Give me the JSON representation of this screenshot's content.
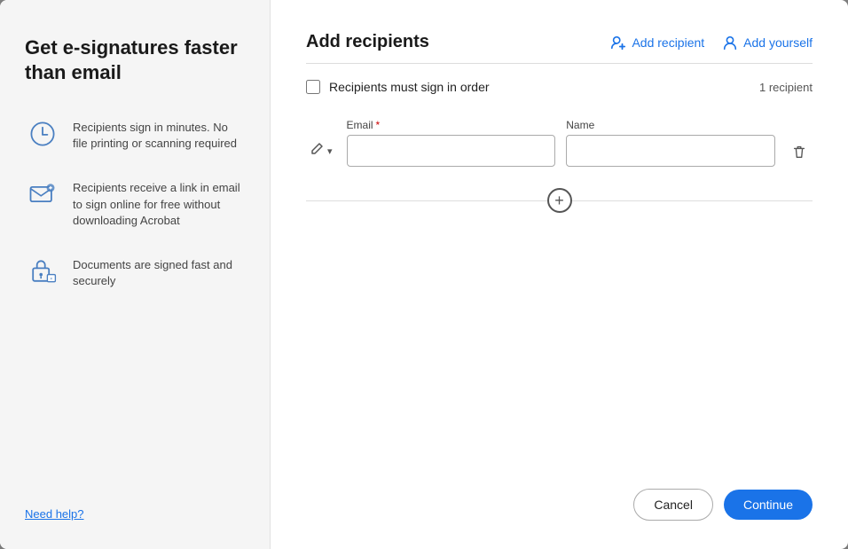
{
  "left": {
    "title": "Get e-signatures faster than email",
    "features": [
      {
        "id": "clock",
        "text": "Recipients sign in minutes. No file printing or scanning required"
      },
      {
        "id": "email",
        "text": "Recipients receive a link in email to sign online for free without downloading Acrobat"
      },
      {
        "id": "secure",
        "text": "Documents are signed fast and securely"
      }
    ],
    "help_label": "Need help?"
  },
  "right": {
    "title": "Add recipients",
    "add_recipient_label": "Add recipient",
    "add_yourself_label": "Add yourself",
    "divider": true,
    "checkbox_label": "Recipients must sign in order",
    "recipient_count": "1 recipient",
    "email_label": "Email",
    "name_label": "Name",
    "email_placeholder": "",
    "name_placeholder": "",
    "cancel_label": "Cancel",
    "continue_label": "Continue"
  }
}
